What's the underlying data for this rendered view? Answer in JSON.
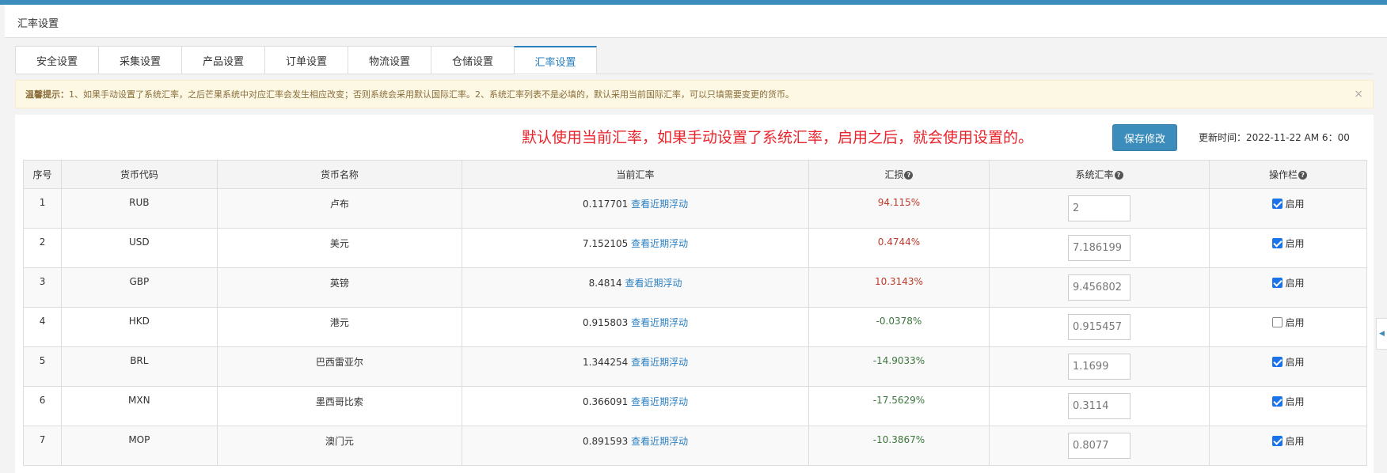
{
  "header": {
    "title": "汇率设置"
  },
  "tabs": [
    {
      "label": "安全设置",
      "active": false
    },
    {
      "label": "采集设置",
      "active": false
    },
    {
      "label": "产品设置",
      "active": false
    },
    {
      "label": "订单设置",
      "active": false
    },
    {
      "label": "物流设置",
      "active": false
    },
    {
      "label": "仓储设置",
      "active": false
    },
    {
      "label": "汇率设置",
      "active": true
    }
  ],
  "alert": {
    "title": "温馨提示：",
    "text": "1、如果手动设置了系统汇率，之后芒果系统中对应汇率会发生相应改变；否则系统会采用默认国际汇率。2、系统汇率列表不是必填的，默认采用当前国际汇率，可以只填需要变更的货币。",
    "close": "×"
  },
  "notice": "默认使用当前汇率，如果手动设置了系统汇率，启用之后，就会使用设置的。",
  "save_label": "保存修改",
  "update_time": "更新时间：2022-11-22 AM 6：00",
  "columns": {
    "index": "序号",
    "code": "货币代码",
    "name": "货币名称",
    "current": "当前汇率",
    "loss": "汇损",
    "system": "系统汇率",
    "action": "操作栏"
  },
  "help_icon": "question-circle-icon",
  "link_text": "查看近期浮动",
  "enable_label": "启用",
  "rows": [
    {
      "index": "1",
      "code": "RUB",
      "name": "卢布",
      "rate": "0.117701",
      "loss": "94.115%",
      "loss_type": "pos",
      "system_rate": "2",
      "enabled": true
    },
    {
      "index": "2",
      "code": "USD",
      "name": "美元",
      "rate": "7.152105",
      "loss": "0.4744%",
      "loss_type": "pos",
      "system_rate": "7.186199",
      "enabled": true
    },
    {
      "index": "3",
      "code": "GBP",
      "name": "英镑",
      "rate": "8.4814",
      "loss": "10.3143%",
      "loss_type": "pos",
      "system_rate": "9.456802",
      "enabled": true
    },
    {
      "index": "4",
      "code": "HKD",
      "name": "港元",
      "rate": "0.915803",
      "loss": "-0.0378%",
      "loss_type": "neg",
      "system_rate": "0.915457",
      "enabled": false
    },
    {
      "index": "5",
      "code": "BRL",
      "name": "巴西雷亚尔",
      "rate": "1.344254",
      "loss": "-14.9033%",
      "loss_type": "neg",
      "system_rate": "1.1699",
      "enabled": true
    },
    {
      "index": "6",
      "code": "MXN",
      "name": "墨西哥比索",
      "rate": "0.366091",
      "loss": "-17.5629%",
      "loss_type": "neg",
      "system_rate": "0.3114",
      "enabled": true
    },
    {
      "index": "7",
      "code": "MOP",
      "name": "澳门元",
      "rate": "0.891593",
      "loss": "-10.3867%",
      "loss_type": "neg",
      "system_rate": "0.8077",
      "enabled": true
    }
  ],
  "colors": {
    "accent": "#3c8dbc",
    "notice": "#e8232b",
    "positive": "#c0392b",
    "negative": "#3c763d"
  }
}
